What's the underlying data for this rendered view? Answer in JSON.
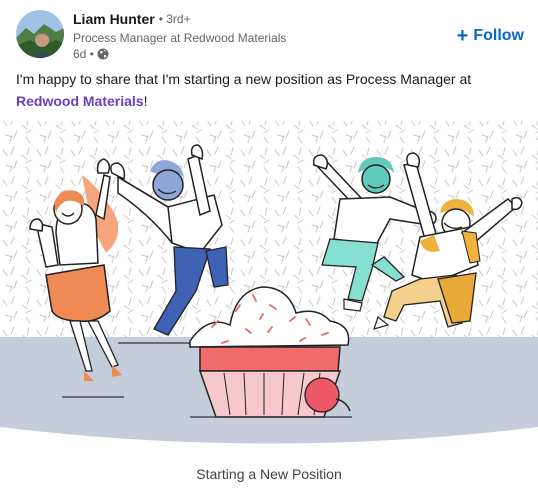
{
  "post": {
    "author": {
      "name": "Liam Hunter",
      "degree": "• 3rd+",
      "headline": "Process Manager at Redwood Materials",
      "time": "6d •",
      "avatar_icon": "profile-photo",
      "visibility_icon": "globe-icon"
    },
    "follow": {
      "plus": "+",
      "label": "Follow"
    },
    "text": {
      "before": "I'm happy to share that I'm starting a new position as Process Manager at ",
      "link": "Redwood Materials",
      "after": "!"
    },
    "image": {
      "caption": "Starting a New Position"
    }
  },
  "colors": {
    "link": "#6a3fc4",
    "follow": "#0a66c2",
    "floor": "#c5cddb",
    "cupcake": "#f06b6b",
    "cherry": "#ec5866"
  }
}
